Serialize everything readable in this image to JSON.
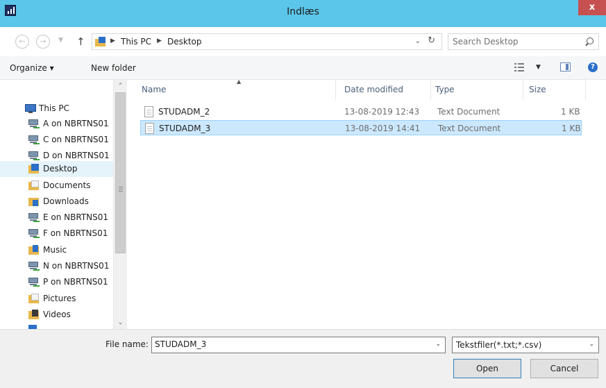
{
  "window": {
    "title": "Indlæs",
    "close_glyph": "x"
  },
  "address": {
    "crumbs": [
      "This PC",
      "Desktop"
    ],
    "search_placeholder": "Search Desktop"
  },
  "commandbar": {
    "organize": "Organize ▾",
    "new_folder": "New folder"
  },
  "sidebar": {
    "items": [
      {
        "label": "This PC",
        "icon": "computer-icon"
      },
      {
        "label": "A on NBRTNS01",
        "icon": "network-drive-icon"
      },
      {
        "label": "C on NBRTNS01",
        "icon": "network-drive-icon"
      },
      {
        "label": "D on NBRTNS01",
        "icon": "network-drive-icon"
      },
      {
        "label": "Desktop",
        "icon": "desktop-folder-icon",
        "selected": true
      },
      {
        "label": "Documents",
        "icon": "documents-folder-icon"
      },
      {
        "label": "Downloads",
        "icon": "downloads-folder-icon"
      },
      {
        "label": "E on NBRTNS01",
        "icon": "network-drive-icon"
      },
      {
        "label": "F on NBRTNS01",
        "icon": "network-drive-icon"
      },
      {
        "label": "Music",
        "icon": "music-folder-icon"
      },
      {
        "label": "N on NBRTNS01",
        "icon": "network-drive-icon"
      },
      {
        "label": "P on NBRTNS01",
        "icon": "network-drive-icon"
      },
      {
        "label": "Pictures",
        "icon": "pictures-folder-icon"
      },
      {
        "label": "Videos",
        "icon": "videos-folder-icon"
      }
    ]
  },
  "filelist": {
    "columns": [
      "Name",
      "Date modified",
      "Type",
      "Size"
    ],
    "rows": [
      {
        "name": "STUDADM_2",
        "date": "13-08-2019 12:43",
        "type": "Text Document",
        "size": "1 KB",
        "selected": false
      },
      {
        "name": "STUDADM_3",
        "date": "13-08-2019 14:41",
        "type": "Text Document",
        "size": "1 KB",
        "selected": true
      }
    ]
  },
  "footer": {
    "filename_label": "File name:",
    "filename_value": "STUDADM_3",
    "filetype_value": "Tekstfiler(*.txt;*.csv)",
    "open_label": "Open",
    "cancel_label": "Cancel"
  },
  "colors": {
    "titlebar": "#5cc6ea",
    "selection": "#cce8ff",
    "close": "#c75050"
  }
}
